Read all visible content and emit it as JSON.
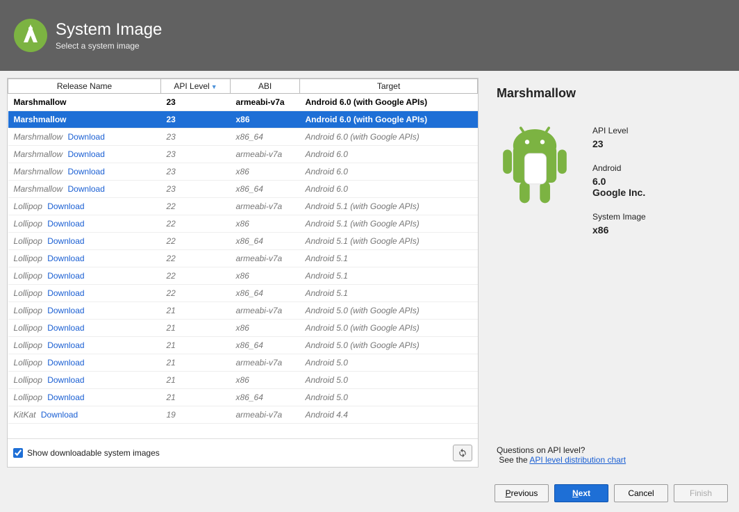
{
  "header": {
    "title": "System Image",
    "subtitle": "Select a system image"
  },
  "table": {
    "columns": [
      "Release Name",
      "API Level",
      "ABI",
      "Target"
    ],
    "sort_column": 1,
    "rows": [
      {
        "release": "Marshmallow",
        "api": "23",
        "abi": "armeabi-v7a",
        "target": "Android 6.0 (with Google APIs)",
        "installed": true,
        "selected": false
      },
      {
        "release": "Marshmallow",
        "api": "23",
        "abi": "x86",
        "target": "Android 6.0 (with Google APIs)",
        "installed": true,
        "selected": true
      },
      {
        "release": "Marshmallow",
        "api": "23",
        "abi": "x86_64",
        "target": "Android 6.0 (with Google APIs)",
        "installed": false
      },
      {
        "release": "Marshmallow",
        "api": "23",
        "abi": "armeabi-v7a",
        "target": "Android 6.0",
        "installed": false
      },
      {
        "release": "Marshmallow",
        "api": "23",
        "abi": "x86",
        "target": "Android 6.0",
        "installed": false
      },
      {
        "release": "Marshmallow",
        "api": "23",
        "abi": "x86_64",
        "target": "Android 6.0",
        "installed": false
      },
      {
        "release": "Lollipop",
        "api": "22",
        "abi": "armeabi-v7a",
        "target": "Android 5.1 (with Google APIs)",
        "installed": false
      },
      {
        "release": "Lollipop",
        "api": "22",
        "abi": "x86",
        "target": "Android 5.1 (with Google APIs)",
        "installed": false
      },
      {
        "release": "Lollipop",
        "api": "22",
        "abi": "x86_64",
        "target": "Android 5.1 (with Google APIs)",
        "installed": false
      },
      {
        "release": "Lollipop",
        "api": "22",
        "abi": "armeabi-v7a",
        "target": "Android 5.1",
        "installed": false
      },
      {
        "release": "Lollipop",
        "api": "22",
        "abi": "x86",
        "target": "Android 5.1",
        "installed": false
      },
      {
        "release": "Lollipop",
        "api": "22",
        "abi": "x86_64",
        "target": "Android 5.1",
        "installed": false
      },
      {
        "release": "Lollipop",
        "api": "21",
        "abi": "armeabi-v7a",
        "target": "Android 5.0 (with Google APIs)",
        "installed": false
      },
      {
        "release": "Lollipop",
        "api": "21",
        "abi": "x86",
        "target": "Android 5.0 (with Google APIs)",
        "installed": false
      },
      {
        "release": "Lollipop",
        "api": "21",
        "abi": "x86_64",
        "target": "Android 5.0 (with Google APIs)",
        "installed": false
      },
      {
        "release": "Lollipop",
        "api": "21",
        "abi": "armeabi-v7a",
        "target": "Android 5.0",
        "installed": false
      },
      {
        "release": "Lollipop",
        "api": "21",
        "abi": "x86",
        "target": "Android 5.0",
        "installed": false
      },
      {
        "release": "Lollipop",
        "api": "21",
        "abi": "x86_64",
        "target": "Android 5.0",
        "installed": false
      },
      {
        "release": "KitKat",
        "api": "19",
        "abi": "armeabi-v7a",
        "target": "Android 4.4",
        "installed": false
      }
    ],
    "download_label": "Download"
  },
  "show_downloadable": {
    "checked": true,
    "label": "Show downloadable system images"
  },
  "detail": {
    "title": "Marshmallow",
    "api_level_label": "API Level",
    "api_level": "23",
    "android_label": "Android",
    "android_version": "6.0",
    "vendor": "Google Inc.",
    "system_image_label": "System Image",
    "system_image": "x86"
  },
  "help": {
    "question": "Questions on API level?",
    "see": "See the ",
    "link": "API level distribution chart"
  },
  "buttons": {
    "previous": "Previous",
    "next": "Next",
    "cancel": "Cancel",
    "finish": "Finish"
  }
}
